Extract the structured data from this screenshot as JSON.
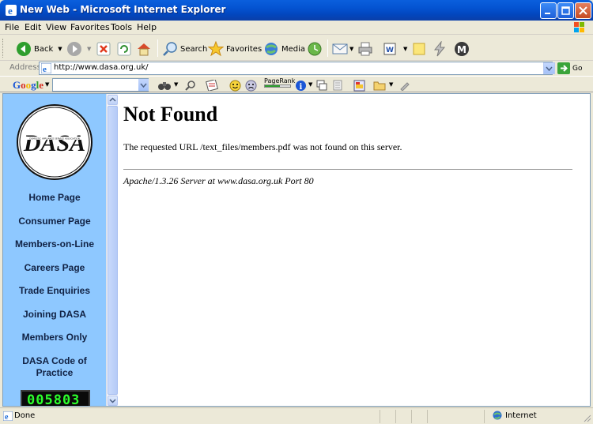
{
  "window": {
    "title": "New Web - Microsoft Internet Explorer"
  },
  "menu": {
    "items": [
      "File",
      "Edit",
      "View",
      "Favorites",
      "Tools",
      "Help"
    ]
  },
  "toolbar": {
    "back": "Back",
    "search": "Search",
    "favorites": "Favorites",
    "media": "Media"
  },
  "address": {
    "label": "Address",
    "url": "http://www.dasa.org.uk/",
    "go": "Go"
  },
  "google": {
    "logo": "Google",
    "pagerank": "PageRank"
  },
  "sidebar": {
    "logo_text": "DASA",
    "logo_subtext": "DOMESTIC APPLIANCE SERVICE ASSOCIATION",
    "links": [
      "Home Page",
      "Consumer Page",
      "Members-on-Line",
      "Careers Page",
      "Trade Enquiries",
      "Joining DASA",
      "Members Only",
      "DASA Code of Practice"
    ],
    "counter": "005803"
  },
  "page": {
    "heading": "Not Found",
    "message": "The requested URL /text_files/members.pdf was not found on this server.",
    "server": "Apache/1.3.26 Server at www.dasa.org.uk Port 80"
  },
  "status": {
    "text": "Done",
    "zone": "Internet"
  }
}
